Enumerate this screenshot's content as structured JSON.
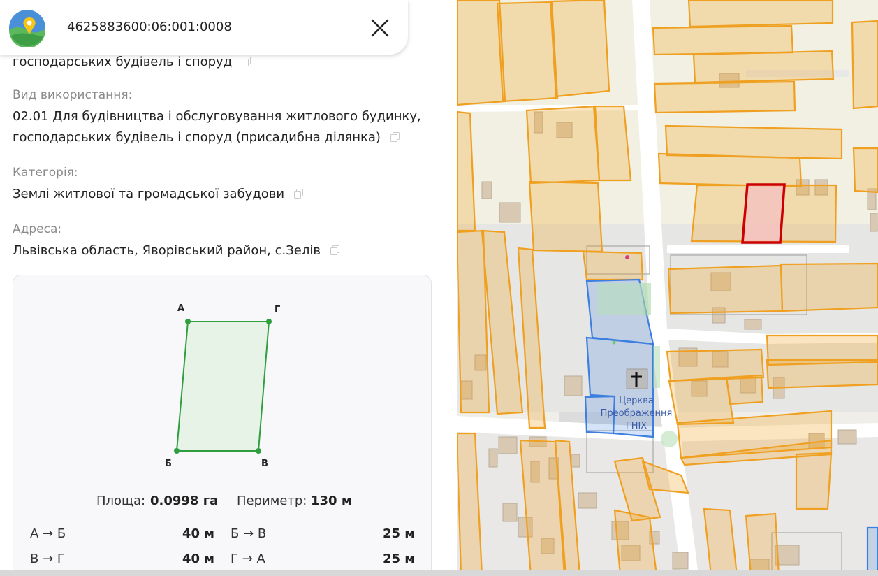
{
  "search": {
    "query": "4625883600:06:001:0008"
  },
  "info": {
    "top_fragment": "господарських будівель і споруд",
    "usage_label": "Вид використання:",
    "usage_value_line1": "02.01 Для будівництва і обслуговування житлового будинку,",
    "usage_value_line2": "господарських будівель і споруд (присадибна ділянка)",
    "category_label": "Категорія:",
    "category_value": "Землі житлової та громадської забудови",
    "address_label": "Адреса:",
    "address_value": "Львівська область, Яворівський район, с.Зелів"
  },
  "parcel": {
    "vertices": [
      "А",
      "Г",
      "Б",
      "В"
    ],
    "area_label": "Площа:",
    "area_value": "0.0998 га",
    "perimeter_label": "Периметр:",
    "perimeter_value": "130 м",
    "sides": [
      {
        "name": "А → Б",
        "length": "40 м"
      },
      {
        "name": "Б → В",
        "length": "25 м"
      },
      {
        "name": "В → Г",
        "length": "40 м"
      },
      {
        "name": "Г → А",
        "length": "25 м"
      }
    ],
    "fill_color": "#e6f3e6",
    "stroke_color": "#2e9e3e"
  },
  "map": {
    "church_label_line1": "Церква",
    "church_label_line2": "Преображення",
    "church_label_line3": "ГНІХ",
    "parcel_color": "#f0a020",
    "selected_color": "#cc0000",
    "church_color": "#3d7fe0"
  }
}
